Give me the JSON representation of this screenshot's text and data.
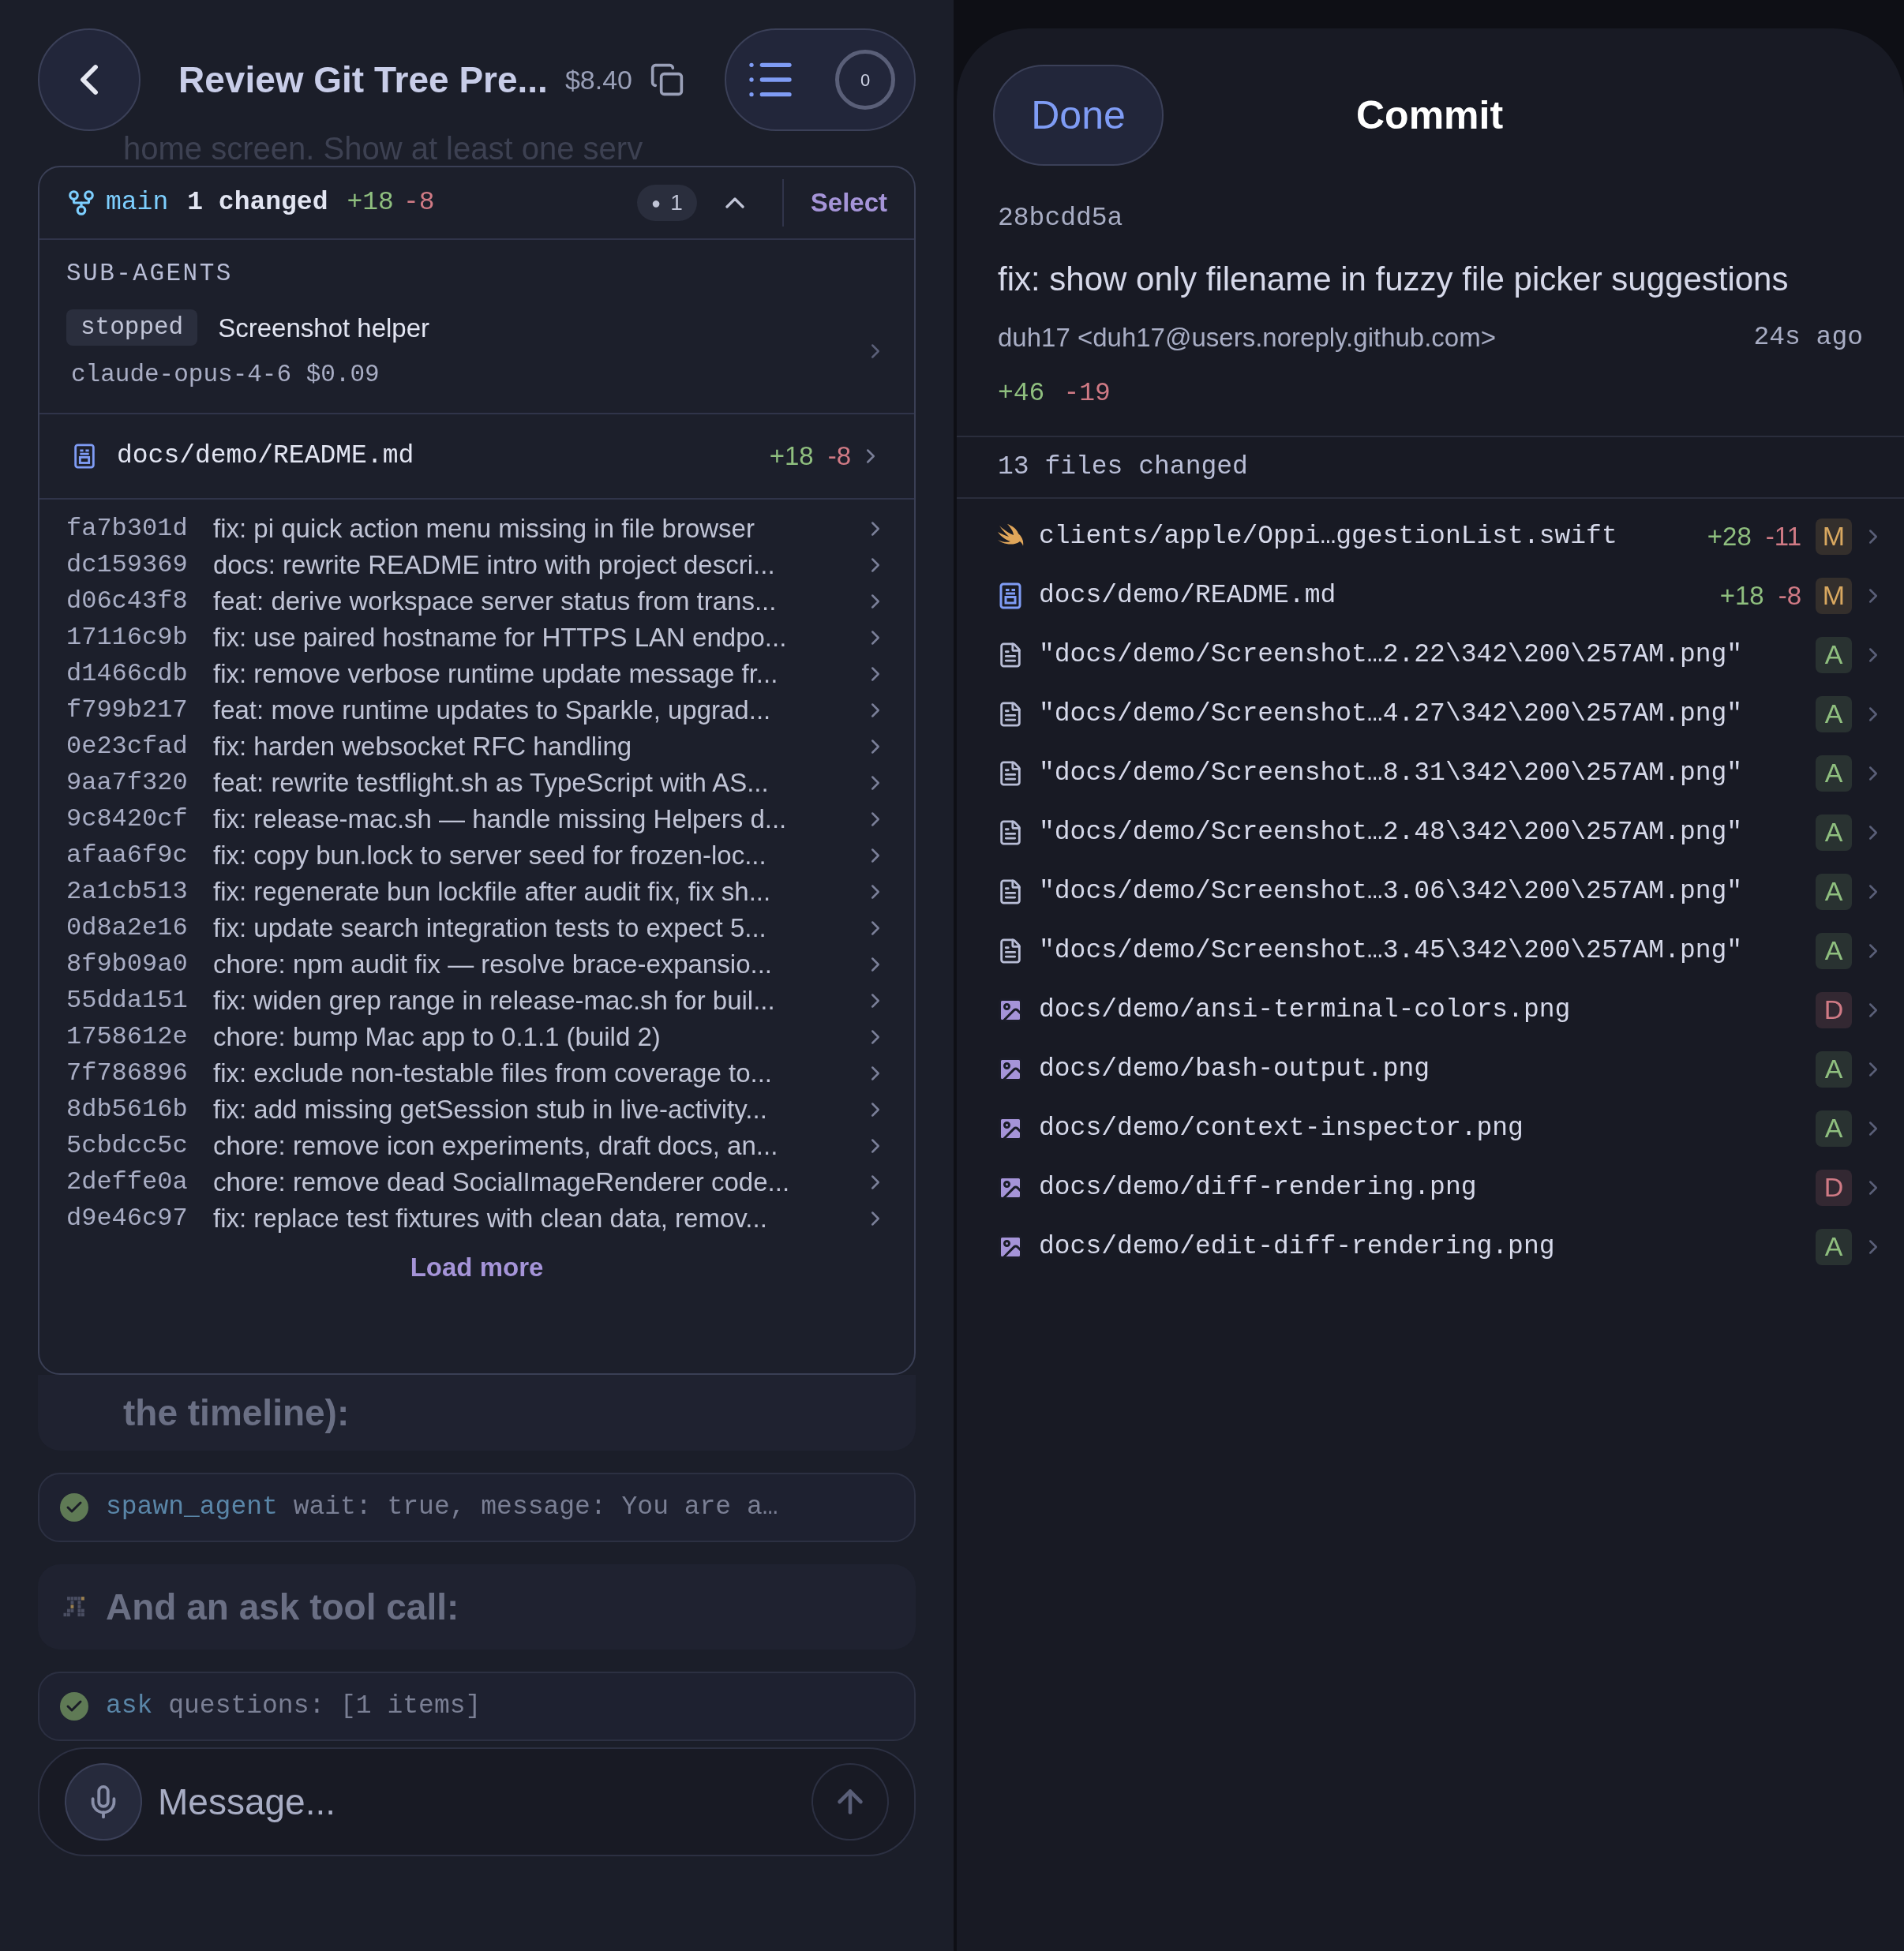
{
  "header": {
    "title": "Review Git Tree Pre...",
    "cost": "$8.40",
    "counter": "0"
  },
  "background_text": {
    "top": "home screen. Show at least one serv",
    "timeline": "the timeline):"
  },
  "git_panel": {
    "branch": "main",
    "changed": "1 changed",
    "added": "+18",
    "removed": "-8",
    "badge_dot": "●",
    "badge_count": "1",
    "expanded": true,
    "select": "Select",
    "sub_agents": {
      "heading": "SUB-AGENTS",
      "agents": [
        {
          "status": "stopped",
          "name": "Screenshot helper",
          "meta": "claude-opus-4-6 $0.09"
        }
      ]
    },
    "files": [
      {
        "path": "docs/demo/README.md",
        "added": "+18",
        "removed": "-8"
      }
    ],
    "commits": [
      {
        "hash": "fa7b301d",
        "message": "fix: pi quick action menu missing in file browser"
      },
      {
        "hash": "dc159369",
        "message": "docs: rewrite README intro with project descri..."
      },
      {
        "hash": "d06c43f8",
        "message": "feat: derive workspace server status from trans..."
      },
      {
        "hash": "17116c9b",
        "message": "fix: use paired hostname for HTTPS LAN endpo..."
      },
      {
        "hash": "d1466cdb",
        "message": "fix: remove verbose runtime update message fr..."
      },
      {
        "hash": "f799b217",
        "message": "feat: move runtime updates to Sparkle, upgrad..."
      },
      {
        "hash": "0e23cfad",
        "message": "fix: harden websocket RFC handling"
      },
      {
        "hash": "9aa7f320",
        "message": "feat: rewrite testflight.sh as TypeScript with AS..."
      },
      {
        "hash": "9c8420cf",
        "message": "fix: release-mac.sh — handle missing Helpers d..."
      },
      {
        "hash": "afaa6f9c",
        "message": "fix: copy bun.lock to server seed for frozen-loc..."
      },
      {
        "hash": "2a1cb513",
        "message": "fix: regenerate bun lockfile after audit fix, fix sh..."
      },
      {
        "hash": "0d8a2e16",
        "message": "fix: update search integration tests to expect 5..."
      },
      {
        "hash": "8f9b09a0",
        "message": "chore: npm audit fix — resolve brace-expansio..."
      },
      {
        "hash": "55dda151",
        "message": "fix: widen grep range in release-mac.sh for buil..."
      },
      {
        "hash": "1758612e",
        "message": "chore: bump Mac app to 0.1.1 (build 2)"
      },
      {
        "hash": "7f786896",
        "message": "fix: exclude non-testable files from coverage to..."
      },
      {
        "hash": "8db5616b",
        "message": "fix: add missing getSession stub in live-activity..."
      },
      {
        "hash": "5cbdcc5c",
        "message": "chore: remove icon experiments, draft docs, an..."
      },
      {
        "hash": "2deffe0a",
        "message": "chore: remove dead SocialImageRenderer code..."
      },
      {
        "hash": "d9e46c97",
        "message": "fix: replace test fixtures with clean data, remov..."
      }
    ],
    "load_more": "Load more"
  },
  "timeline": [
    {
      "kind": "tool",
      "tool": "spawn_agent",
      "args": "wait: true, message: You are a…"
    },
    {
      "kind": "text",
      "text": "And an ask tool call:"
    },
    {
      "kind": "tool",
      "tool": "ask",
      "args": "questions: [1 items]"
    }
  ],
  "composer": {
    "placeholder": "Message..."
  },
  "commit_sheet": {
    "done": "Done",
    "title": "Commit",
    "hash": "28bcdd5a",
    "subject": "fix: show only filename in fuzzy file picker suggestions",
    "author": "duh17 <duh17@users.noreply.github.com>",
    "time": "24s ago",
    "added": "+46",
    "removed": "-19",
    "files_heading": "13 files changed",
    "files": [
      {
        "kind": "swift",
        "path": "clients/apple/Oppi…ggestionList.swift",
        "added": "+28",
        "removed": "-11",
        "status": "M",
        "color": "#d9a860"
      },
      {
        "kind": "readme",
        "path": "docs/demo/README.md",
        "added": "+18",
        "removed": "-8",
        "status": "M",
        "color": "#d9a860"
      },
      {
        "kind": "file",
        "path": "\"docs/demo/Screenshot…2.22\\342\\200\\257AM.png\"",
        "status": "A",
        "color": "#8fbf7f"
      },
      {
        "kind": "file",
        "path": "\"docs/demo/Screenshot…4.27\\342\\200\\257AM.png\"",
        "status": "A",
        "color": "#8fbf7f"
      },
      {
        "kind": "file",
        "path": "\"docs/demo/Screenshot…8.31\\342\\200\\257AM.png\"",
        "status": "A",
        "color": "#8fbf7f"
      },
      {
        "kind": "file",
        "path": "\"docs/demo/Screenshot…2.48\\342\\200\\257AM.png\"",
        "status": "A",
        "color": "#8fbf7f"
      },
      {
        "kind": "file",
        "path": "\"docs/demo/Screenshot…3.06\\342\\200\\257AM.png\"",
        "status": "A",
        "color": "#8fbf7f"
      },
      {
        "kind": "file",
        "path": "\"docs/demo/Screenshot…3.45\\342\\200\\257AM.png\"",
        "status": "A",
        "color": "#8fbf7f"
      },
      {
        "kind": "image",
        "path": "docs/demo/ansi-terminal-colors.png",
        "status": "D",
        "color": "#d07a85"
      },
      {
        "kind": "image",
        "path": "docs/demo/bash-output.png",
        "status": "A",
        "color": "#8fbf7f"
      },
      {
        "kind": "image",
        "path": "docs/demo/context-inspector.png",
        "status": "A",
        "color": "#8fbf7f"
      },
      {
        "kind": "image",
        "path": "docs/demo/diff-rendering.png",
        "status": "D",
        "color": "#d07a85"
      },
      {
        "kind": "image",
        "path": "docs/demo/edit-diff-rendering.png",
        "status": "A",
        "color": "#8fbf7f"
      }
    ]
  }
}
